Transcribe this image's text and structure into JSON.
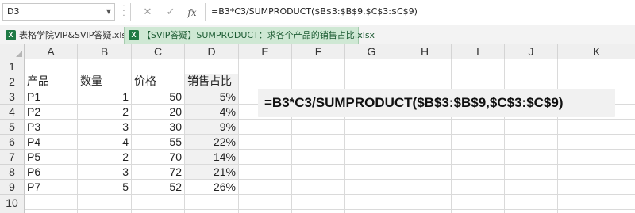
{
  "formula_bar": {
    "name_box": "D3",
    "cancel_symbol": "✕",
    "enter_symbol": "✓",
    "fx_label": "fx",
    "formula": "=B3*C3/SUMPRODUCT($B$3:$B$9,$C$3:$C$9)"
  },
  "tabs": [
    {
      "label": "表格学院VIP&SVIP答疑.xlsx",
      "active": false
    },
    {
      "label": "【SVIP答疑】SUMPRODUCT：求各个产品的销售占比.xlsx",
      "active": true
    }
  ],
  "columns": [
    "A",
    "B",
    "C",
    "D",
    "E",
    "F",
    "G",
    "H",
    "I",
    "J",
    "K"
  ],
  "rows": [
    "1",
    "2",
    "3",
    "4",
    "5",
    "6",
    "7",
    "8",
    "9",
    "10"
  ],
  "table": {
    "headers": [
      "产品",
      "数量",
      "价格",
      "销售占比"
    ],
    "records": [
      {
        "product": "P1",
        "qty": "1",
        "price": "50",
        "share": "5%"
      },
      {
        "product": "P2",
        "qty": "2",
        "price": "20",
        "share": "4%"
      },
      {
        "product": "P3",
        "qty": "3",
        "price": "30",
        "share": "9%"
      },
      {
        "product": "P4",
        "qty": "4",
        "price": "55",
        "share": "22%"
      },
      {
        "product": "P5",
        "qty": "2",
        "price": "70",
        "share": "14%"
      },
      {
        "product": "P6",
        "qty": "3",
        "price": "72",
        "share": "21%"
      },
      {
        "product": "P7",
        "qty": "5",
        "price": "52",
        "share": "26%"
      }
    ]
  },
  "callout": "=B3*C3/SUMPRODUCT($B$3:$B$9,$C$3:$C$9)",
  "colors": {
    "excel_green": "#1f7a45",
    "active_tab": "#cfe8d4",
    "header_bg": "#efefef"
  }
}
